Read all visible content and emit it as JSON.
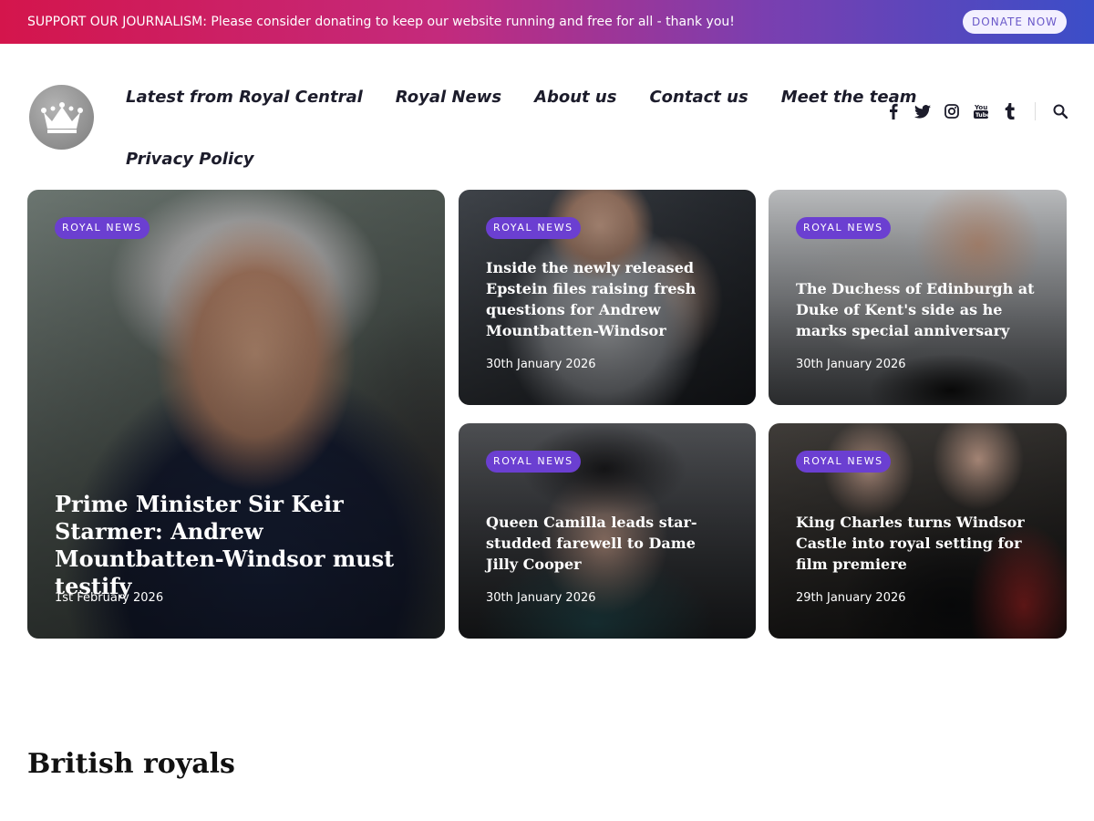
{
  "banner": {
    "text": "SUPPORT OUR JOURNALISM: Please consider donating to keep our website running and free for all - thank you!",
    "button": "DONATE NOW"
  },
  "nav": {
    "items": [
      "Latest from Royal Central",
      "Royal News",
      "About us",
      "Contact us",
      "Meet the team",
      "Privacy Policy"
    ]
  },
  "social": [
    "facebook-icon",
    "twitter-icon",
    "instagram-icon",
    "youtube-icon",
    "tumblr-icon",
    "search-icon"
  ],
  "cards": [
    {
      "tag": "ROYAL NEWS",
      "title": "Prime Minister Sir Keir Starmer: Andrew Mountbatten-Windsor must testify",
      "date": "1st February 2026"
    },
    {
      "tag": "ROYAL NEWS",
      "title": "Inside the newly released Epstein files raising fresh questions for Andrew Mountbatten-Windsor",
      "date": "30th January 2026"
    },
    {
      "tag": "ROYAL NEWS",
      "title": "The Duchess of Edinburgh at Duke of Kent's side as he marks special anniversary",
      "date": "30th January 2026"
    },
    {
      "tag": "ROYAL NEWS",
      "title": "Queen Camilla leads star-studded farewell to Dame Jilly Cooper",
      "date": "30th January 2026"
    },
    {
      "tag": "ROYAL NEWS",
      "title": "King Charles turns Windsor Castle into royal setting for film premiere",
      "date": "29th January 2026"
    }
  ],
  "section": {
    "title": "British royals"
  },
  "colors": {
    "tag": "#6b3fd1",
    "banner_start": "#d4154c",
    "banner_end": "#3b4ec8"
  }
}
